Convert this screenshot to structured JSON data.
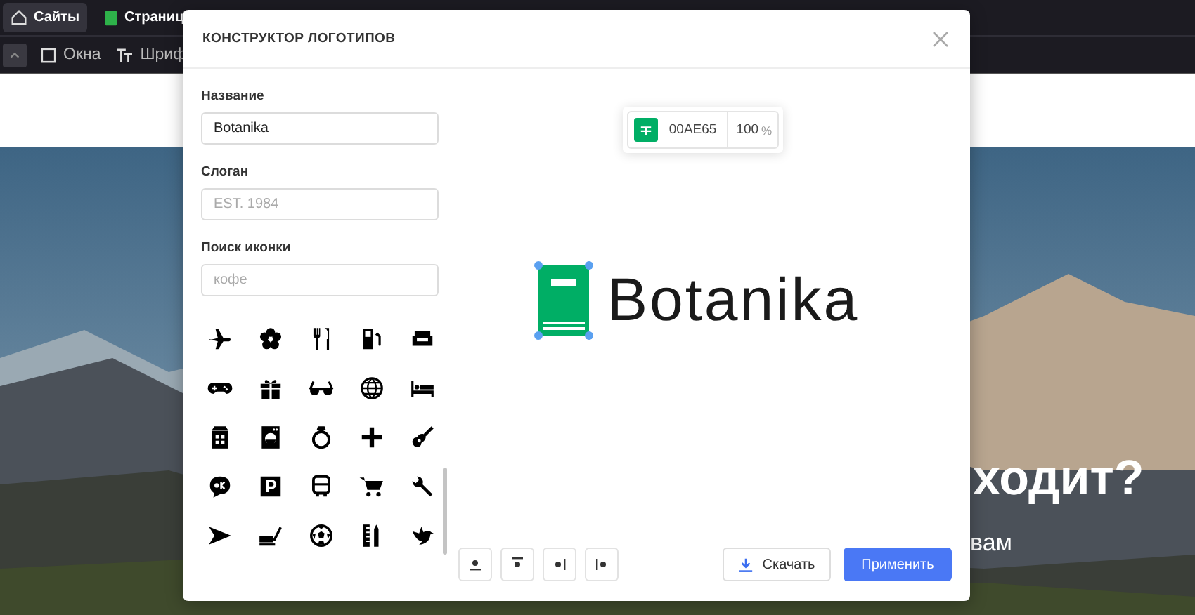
{
  "top_bar": {
    "items": [
      {
        "label": "Сайты",
        "selected": true
      },
      {
        "label": "Страниц",
        "selected": false
      }
    ]
  },
  "toolbar": {
    "items": [
      "Окна",
      "Шриф"
    ]
  },
  "hero": {
    "heading": "ходит?",
    "subtitle": "вам"
  },
  "modal": {
    "title": "КОНСТРУКТОР ЛОГОТИПОВ",
    "fields": [
      {
        "label": "Название",
        "value": "Botanika"
      },
      {
        "label": "Слоган",
        "placeholder": "EST. 1984"
      },
      {
        "label": "Поиск иконки",
        "placeholder": "кофе"
      }
    ],
    "color": {
      "hex": "00AE65",
      "opacity": "100",
      "unit": "%"
    },
    "logo": {
      "name": "Botanika"
    },
    "download_button": "Скачать",
    "apply_button": "Применить"
  }
}
